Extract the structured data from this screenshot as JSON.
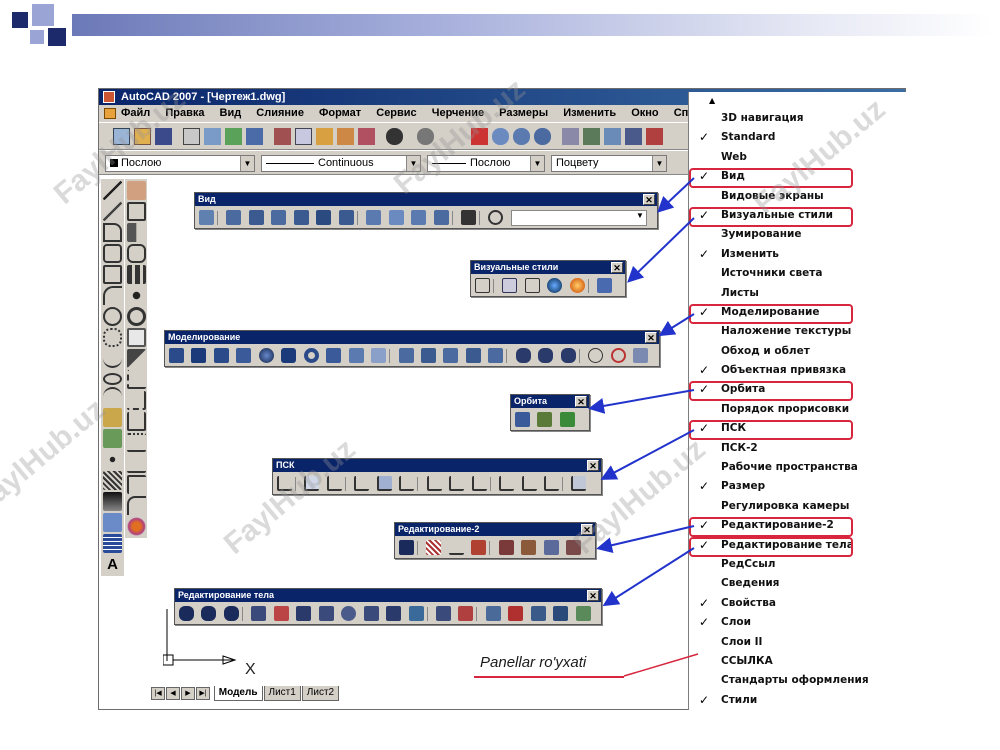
{
  "window": {
    "title": "AutoCAD 2007 - [Чертеж1.dwg]",
    "menu": [
      "Файл",
      "Правка",
      "Вид",
      "Слияние",
      "Формат",
      "Сервис",
      "Черчение",
      "Размеры",
      "Изменить",
      "Окно",
      "Спра"
    ]
  },
  "properties_bar": {
    "layer": "Послою",
    "linetype": "Continuous",
    "lineweight": "Послою",
    "color": "Поцвету"
  },
  "toolbars": {
    "vid": {
      "title": "Вид"
    },
    "vizualnye": {
      "title": "Визуальные стили"
    },
    "modelirovanie": {
      "title": "Моделирование"
    },
    "orbita": {
      "title": "Орбита"
    },
    "psk": {
      "title": "ПСК"
    },
    "redakt2": {
      "title": "Редактирование-2"
    },
    "redakt_tela": {
      "title": "Редактирование тела"
    }
  },
  "layout_tabs": [
    "Модель",
    "Лист1",
    "Лист2"
  ],
  "ucs_label": "X",
  "context_menu": {
    "items": [
      {
        "label": "3D навигация",
        "checked": false,
        "highlight": false
      },
      {
        "label": "Standard",
        "checked": true,
        "highlight": false
      },
      {
        "label": "Web",
        "checked": false,
        "highlight": false
      },
      {
        "label": "Вид",
        "checked": true,
        "highlight": true
      },
      {
        "label": "Видовые экраны",
        "checked": false,
        "highlight": false
      },
      {
        "label": "Визуальные стили",
        "checked": true,
        "highlight": true
      },
      {
        "label": "Зумирование",
        "checked": false,
        "highlight": false
      },
      {
        "label": "Изменить",
        "checked": true,
        "highlight": false
      },
      {
        "label": "Источники света",
        "checked": false,
        "highlight": false
      },
      {
        "label": "Листы",
        "checked": false,
        "highlight": false
      },
      {
        "label": "Моделирование",
        "checked": true,
        "highlight": true
      },
      {
        "label": "Наложение текстуры",
        "checked": false,
        "highlight": false
      },
      {
        "label": "Обход и облет",
        "checked": false,
        "highlight": false
      },
      {
        "label": "Объектная привязка",
        "checked": true,
        "highlight": false
      },
      {
        "label": "Орбита",
        "checked": true,
        "highlight": true
      },
      {
        "label": "Порядок прорисовки",
        "checked": false,
        "highlight": false
      },
      {
        "label": "ПСК",
        "checked": true,
        "highlight": true
      },
      {
        "label": "ПСК-2",
        "checked": false,
        "highlight": false
      },
      {
        "label": "Рабочие пространства",
        "checked": false,
        "highlight": false
      },
      {
        "label": "Размер",
        "checked": true,
        "highlight": false
      },
      {
        "label": "Регулировка камеры",
        "checked": false,
        "highlight": false
      },
      {
        "label": "Редактирование-2",
        "checked": true,
        "highlight": true
      },
      {
        "label": "Редактирование тела",
        "checked": true,
        "highlight": true
      },
      {
        "label": "РедСсыл",
        "checked": false,
        "highlight": false
      },
      {
        "label": "Сведения",
        "checked": false,
        "highlight": false
      },
      {
        "label": "Свойства",
        "checked": true,
        "highlight": false
      },
      {
        "label": "Слои",
        "checked": true,
        "highlight": false
      },
      {
        "label": "Слои II",
        "checked": false,
        "highlight": false
      },
      {
        "label": "ССЫЛКА",
        "checked": false,
        "highlight": false
      },
      {
        "label": "Стандарты оформления",
        "checked": false,
        "highlight": false
      },
      {
        "label": "Стили",
        "checked": true,
        "highlight": false
      }
    ]
  },
  "caption": "Panellar ro'yxati",
  "watermark": "FaylHub.uz",
  "colors": {
    "highlight": "#d7263d",
    "arrow": "#2233cc",
    "titlebar": "#0a246a"
  }
}
